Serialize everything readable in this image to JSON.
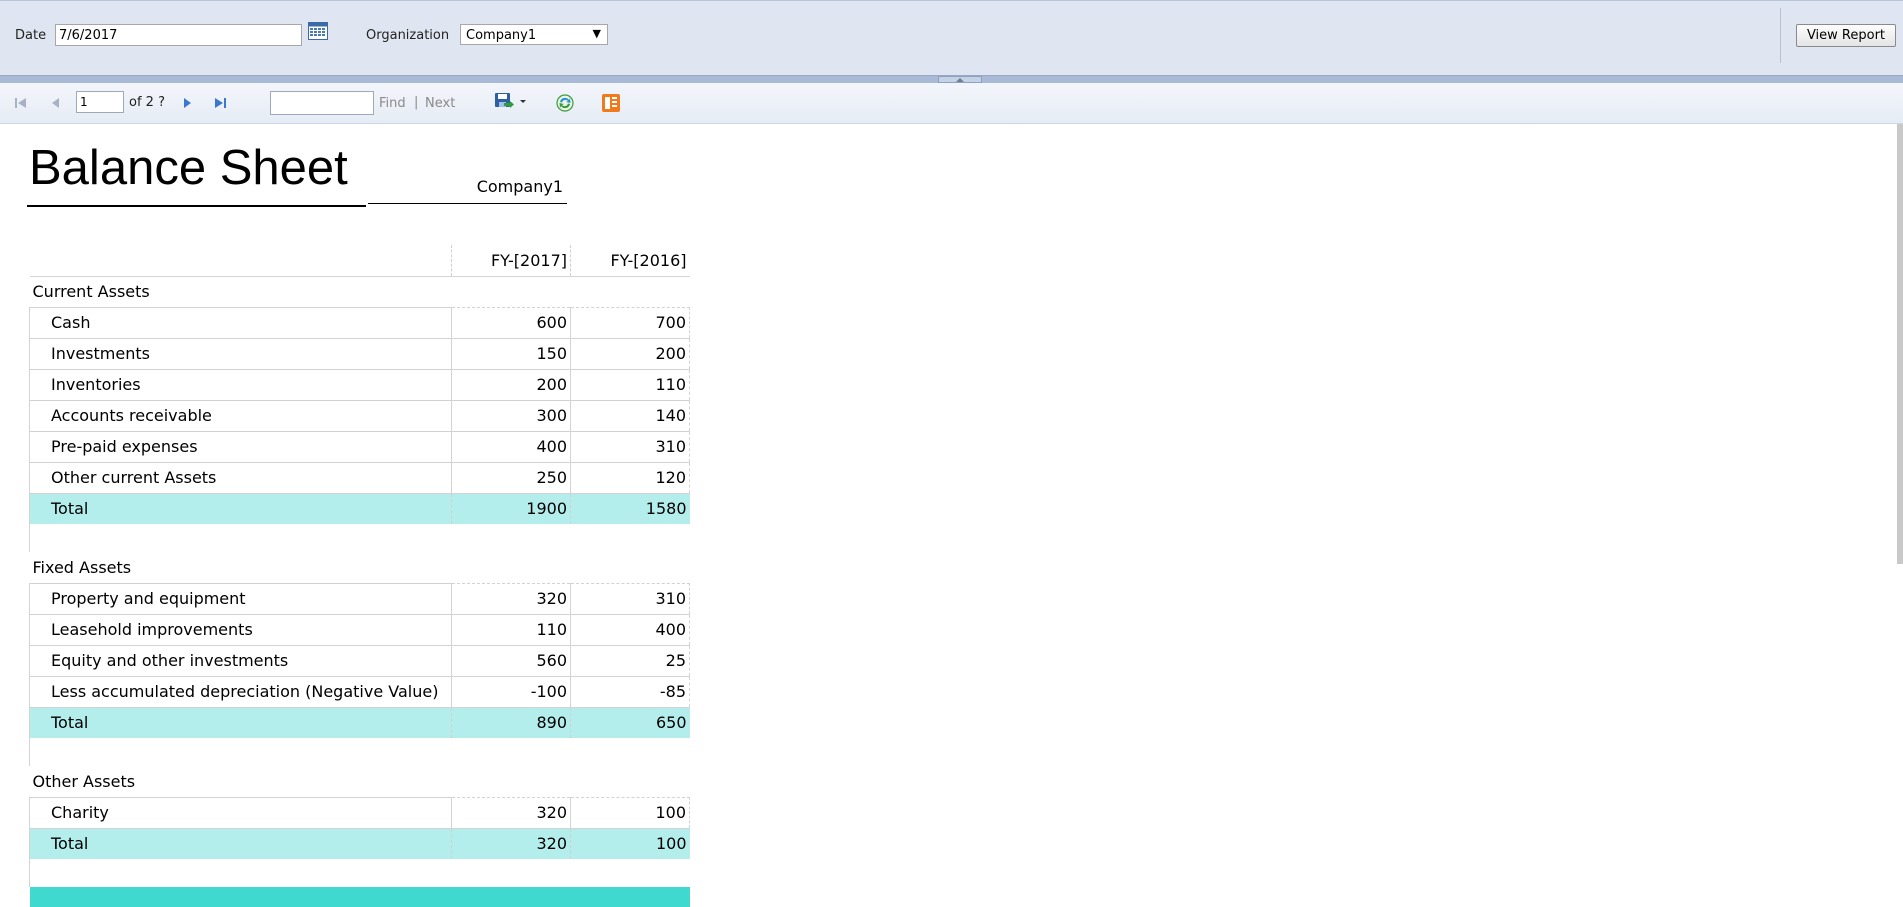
{
  "params": {
    "date_label": "Date",
    "date_value": "7/6/2017",
    "org_label": "Organization",
    "org_value": "Company1",
    "view_report": "View Report"
  },
  "toolbar": {
    "page_value": "1",
    "of_text": "of 2 ?",
    "find_label": "Find",
    "separator": "|",
    "next_label": "Next"
  },
  "report": {
    "title": "Balance Sheet",
    "company": "Company1",
    "col1": "FY-[2017]",
    "col2": "FY-[2016]",
    "sections": [
      {
        "name": "Current Assets",
        "rows": [
          {
            "label": "Cash",
            "v1": "600",
            "v2": "700"
          },
          {
            "label": "Investments",
            "v1": "150",
            "v2": "200"
          },
          {
            "label": "Inventories",
            "v1": "200",
            "v2": "110"
          },
          {
            "label": "Accounts receivable",
            "v1": "300",
            "v2": "140"
          },
          {
            "label": "Pre-paid expenses",
            "v1": "400",
            "v2": "310"
          },
          {
            "label": "Other current Assets",
            "v1": "250",
            "v2": "120"
          }
        ],
        "total": {
          "label": "Total",
          "v1": "1900",
          "v2": "1580"
        }
      },
      {
        "name": "Fixed Assets",
        "rows": [
          {
            "label": "Property and equipment",
            "v1": "320",
            "v2": "310"
          },
          {
            "label": "Leasehold improvements",
            "v1": "110",
            "v2": "400"
          },
          {
            "label": "Equity and other investments",
            "v1": "560",
            "v2": "25"
          },
          {
            "label": "Less accumulated depreciation (Negative Value)",
            "v1": "-100",
            "v2": "-85"
          }
        ],
        "total": {
          "label": "Total",
          "v1": "890",
          "v2": "650"
        }
      },
      {
        "name": "Other Assets",
        "rows": [
          {
            "label": "Charity",
            "v1": "320",
            "v2": "100"
          }
        ],
        "total": {
          "label": "Total",
          "v1": "320",
          "v2": "100"
        }
      }
    ]
  },
  "colors": {
    "param_bg": "#dfe6f1",
    "total_row": "#b3eeed",
    "grand_total_row": "#3fd9cf"
  }
}
